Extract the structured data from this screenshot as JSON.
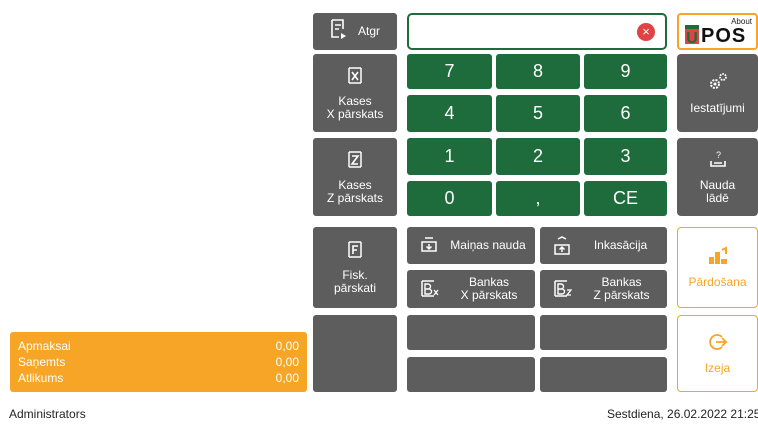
{
  "summary": {
    "rows": [
      {
        "label": "Apmaksai",
        "value": "0,00"
      },
      {
        "label": "Saņemts",
        "value": "0,00"
      },
      {
        "label": "Atlikums",
        "value": "0,00"
      }
    ]
  },
  "left_buttons": {
    "atgr": "Atgr",
    "kases_x": "Kases\nX pārskats",
    "kases_z": "Kases\nZ pārskats",
    "fisk": "Fisk.\npārskati"
  },
  "keypad": {
    "keys": [
      "7",
      "8",
      "9",
      "4",
      "5",
      "6",
      "1",
      "2",
      "3",
      "0",
      ",",
      "CE"
    ]
  },
  "clear_icon": "×",
  "actions": {
    "mainas_nauda": "Maiņas nauda",
    "inkasacija": "Inkasācija",
    "bankas_x": "Bankas\nX pārskats",
    "bankas_z": "Bankas\nZ pārskats"
  },
  "logo": {
    "about": "About",
    "brand": "POS",
    "mark": "U"
  },
  "right_buttons": {
    "iestatijumi": "Iestatījumi",
    "nauda_lade": "Nauda\nlādē",
    "pardosana": "Pārdošana",
    "izeja": "Izeja"
  },
  "footer": {
    "user": "Administrators",
    "datetime": "Sestdiena, 26.02.2022 21:25"
  },
  "colors": {
    "accent": "#f7a526",
    "keypad": "#1e6b3c",
    "button": "#5d5d5d",
    "clear": "#e04343"
  }
}
